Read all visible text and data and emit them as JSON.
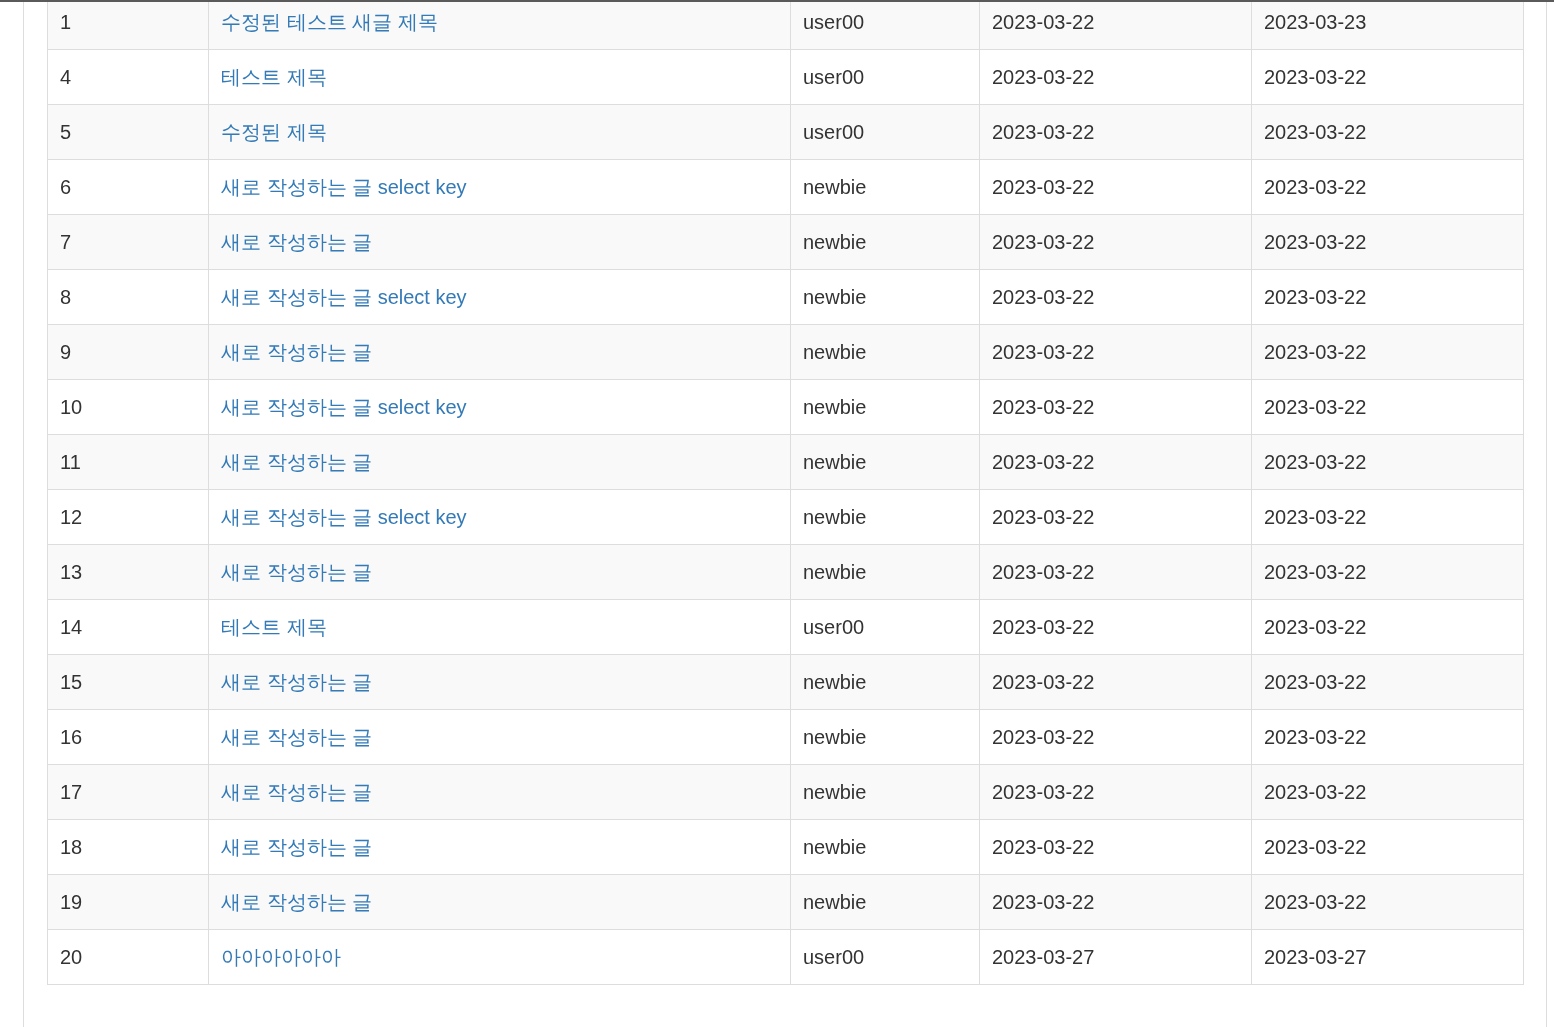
{
  "table": {
    "rows": [
      {
        "no": "1",
        "title": "수정된 테스트 새글 제목",
        "writer": "user00",
        "regdate": "2023-03-22",
        "updatedate": "2023-03-23"
      },
      {
        "no": "4",
        "title": "테스트 제목",
        "writer": "user00",
        "regdate": "2023-03-22",
        "updatedate": "2023-03-22"
      },
      {
        "no": "5",
        "title": "수정된 제목",
        "writer": "user00",
        "regdate": "2023-03-22",
        "updatedate": "2023-03-22"
      },
      {
        "no": "6",
        "title": "새로 작성하는 글 select key",
        "writer": "newbie",
        "regdate": "2023-03-22",
        "updatedate": "2023-03-22"
      },
      {
        "no": "7",
        "title": "새로 작성하는 글",
        "writer": "newbie",
        "regdate": "2023-03-22",
        "updatedate": "2023-03-22"
      },
      {
        "no": "8",
        "title": "새로 작성하는 글 select key",
        "writer": "newbie",
        "regdate": "2023-03-22",
        "updatedate": "2023-03-22"
      },
      {
        "no": "9",
        "title": "새로 작성하는 글",
        "writer": "newbie",
        "regdate": "2023-03-22",
        "updatedate": "2023-03-22"
      },
      {
        "no": "10",
        "title": "새로 작성하는 글 select key",
        "writer": "newbie",
        "regdate": "2023-03-22",
        "updatedate": "2023-03-22"
      },
      {
        "no": "11",
        "title": "새로 작성하는 글",
        "writer": "newbie",
        "regdate": "2023-03-22",
        "updatedate": "2023-03-22"
      },
      {
        "no": "12",
        "title": "새로 작성하는 글 select key",
        "writer": "newbie",
        "regdate": "2023-03-22",
        "updatedate": "2023-03-22"
      },
      {
        "no": "13",
        "title": "새로 작성하는 글",
        "writer": "newbie",
        "regdate": "2023-03-22",
        "updatedate": "2023-03-22"
      },
      {
        "no": "14",
        "title": "테스트 제목",
        "writer": "user00",
        "regdate": "2023-03-22",
        "updatedate": "2023-03-22"
      },
      {
        "no": "15",
        "title": "새로 작성하는 글",
        "writer": "newbie",
        "regdate": "2023-03-22",
        "updatedate": "2023-03-22"
      },
      {
        "no": "16",
        "title": "새로 작성하는 글",
        "writer": "newbie",
        "regdate": "2023-03-22",
        "updatedate": "2023-03-22"
      },
      {
        "no": "17",
        "title": "새로 작성하는 글",
        "writer": "newbie",
        "regdate": "2023-03-22",
        "updatedate": "2023-03-22"
      },
      {
        "no": "18",
        "title": "새로 작성하는 글",
        "writer": "newbie",
        "regdate": "2023-03-22",
        "updatedate": "2023-03-22"
      },
      {
        "no": "19",
        "title": "새로 작성하는 글",
        "writer": "newbie",
        "regdate": "2023-03-22",
        "updatedate": "2023-03-22"
      },
      {
        "no": "20",
        "title": "아아아아아아",
        "writer": "user00",
        "regdate": "2023-03-27",
        "updatedate": "2023-03-27"
      }
    ]
  }
}
